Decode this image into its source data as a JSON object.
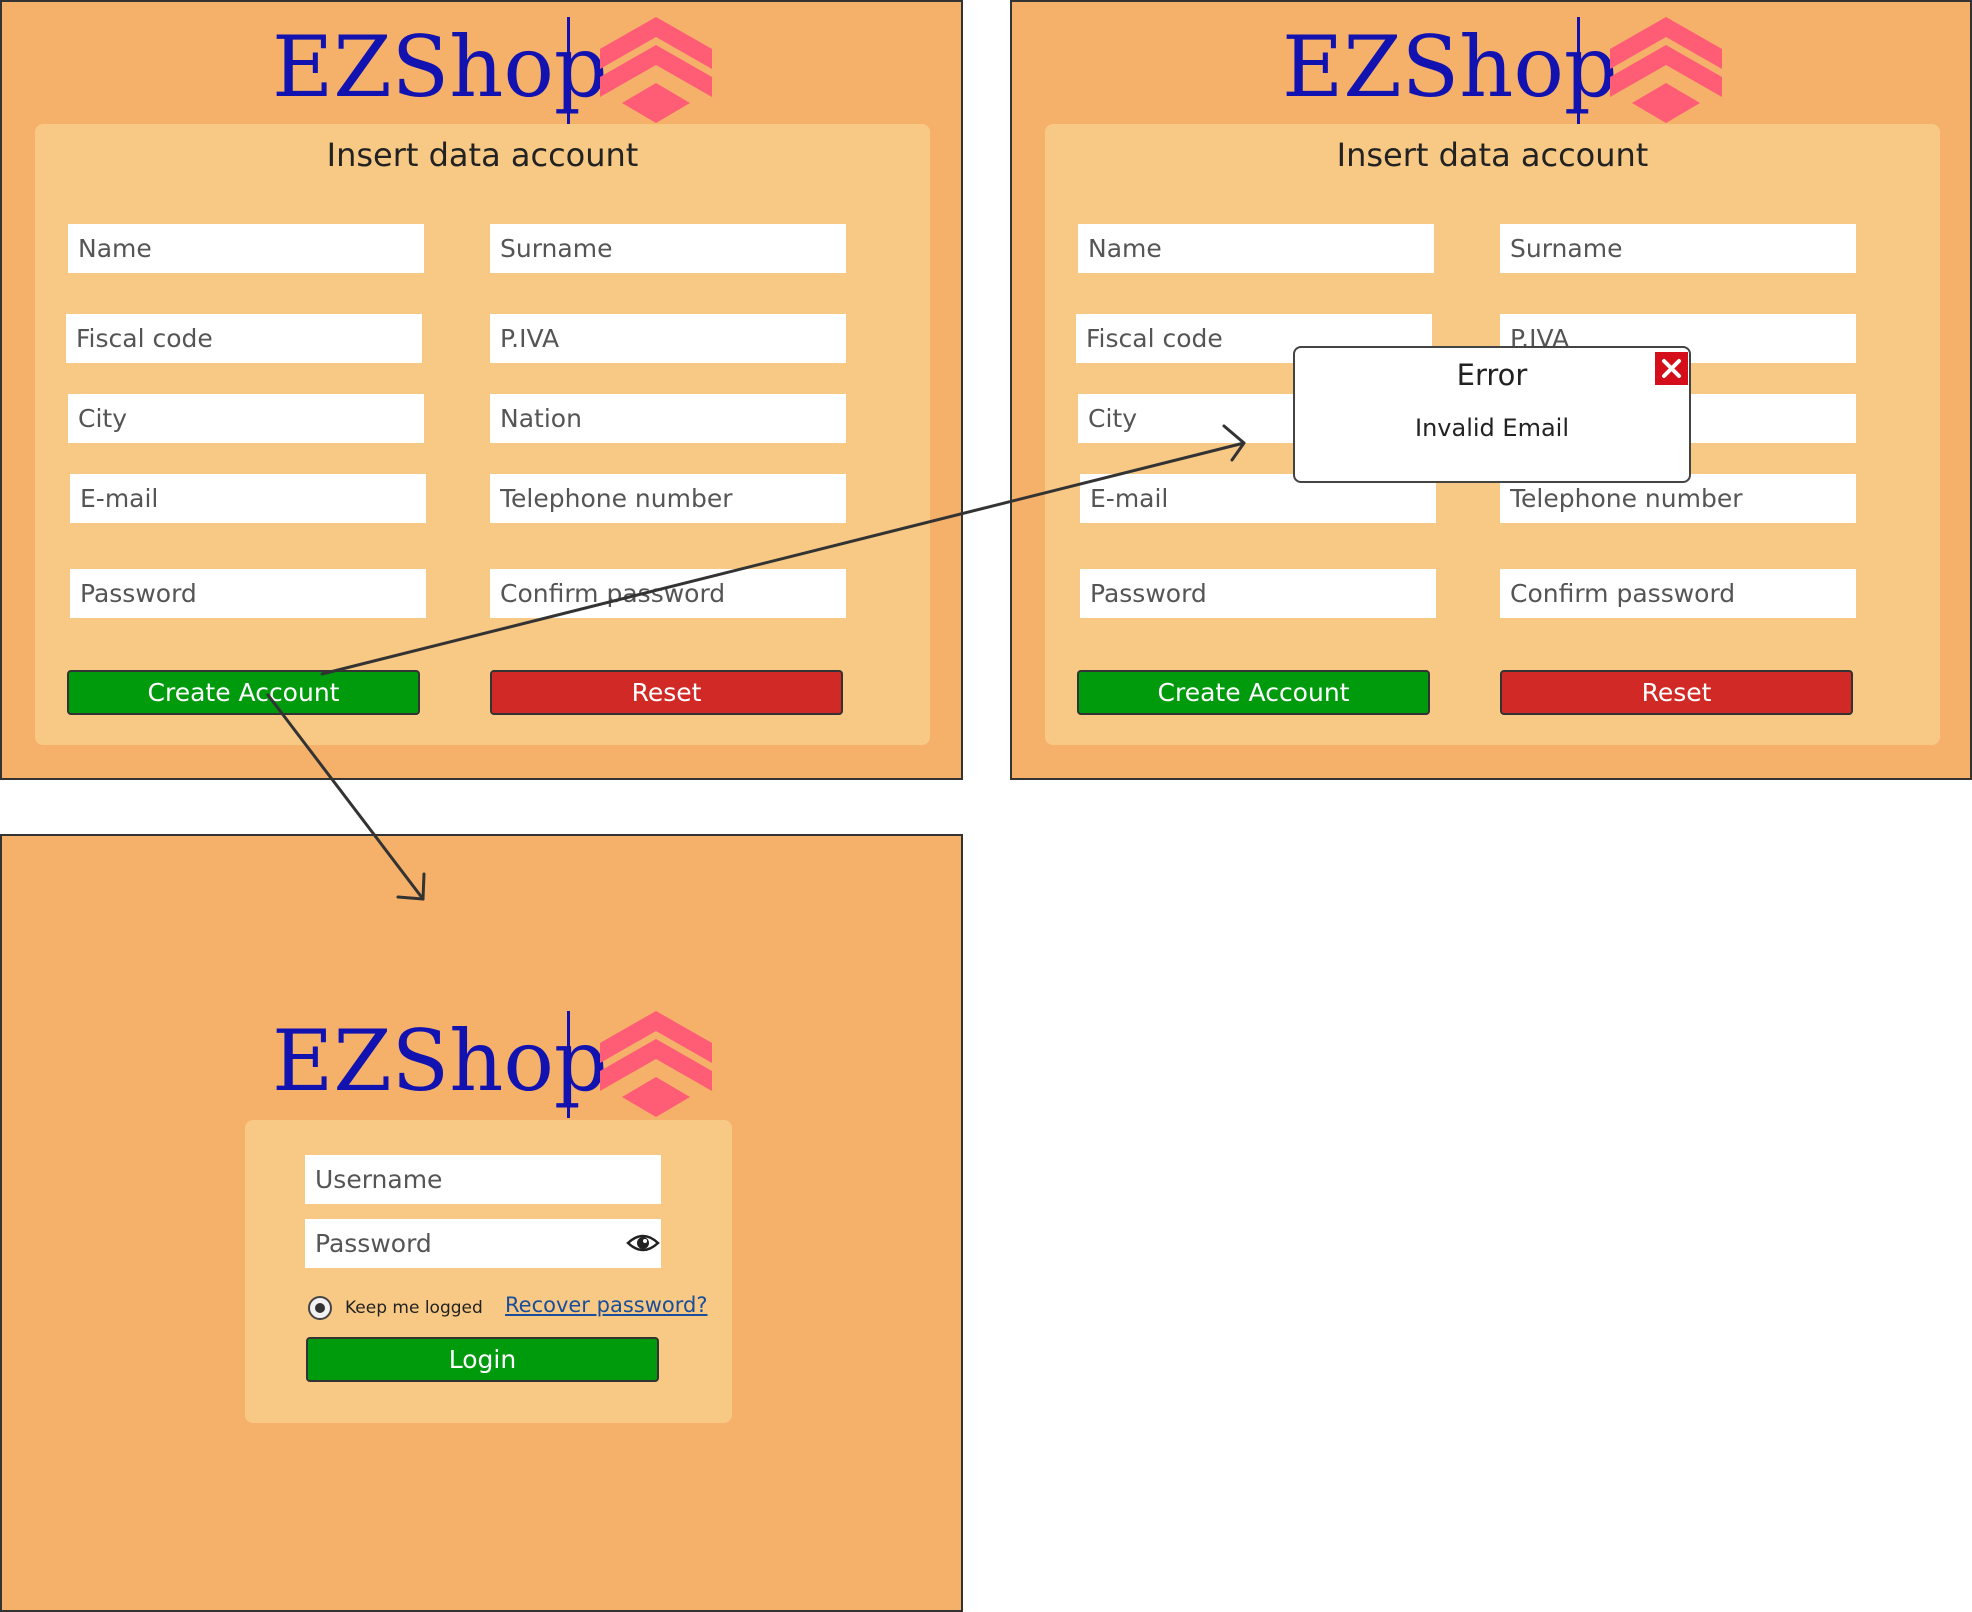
{
  "brand": {
    "name": "EZShop",
    "name_color": "#1212b0",
    "logo_icon": "chevron-stack-logo-icon",
    "logo_color": "#ff5c76"
  },
  "signup_form": {
    "title": "Insert data account",
    "fields": {
      "name": "Name",
      "surname": "Surname",
      "fiscal_code": "Fiscal code",
      "piva": "P.IVA",
      "city": "City",
      "nation": "Nation",
      "email": "E-mail",
      "telephone": "Telephone number",
      "password": "Password",
      "confirm_password": "Confirm password"
    },
    "create_button": "Create Account",
    "reset_button": "Reset"
  },
  "error_dialog": {
    "title": "Error",
    "message": "Invalid Email",
    "close_icon": "close-x-icon"
  },
  "login_form": {
    "username_placeholder": "Username",
    "password_placeholder": "Password",
    "password_toggle_icon": "eye-icon",
    "keep_logged_label": "Keep me logged",
    "keep_logged_selected": true,
    "recover_link": "Recover password?",
    "login_button": "Login"
  },
  "colors": {
    "screen_background": "#f5b06a",
    "card_background": "#f8c985",
    "primary_button": "#009a0d",
    "danger_button": "#d12a26",
    "error_close": "#d40f1b"
  }
}
